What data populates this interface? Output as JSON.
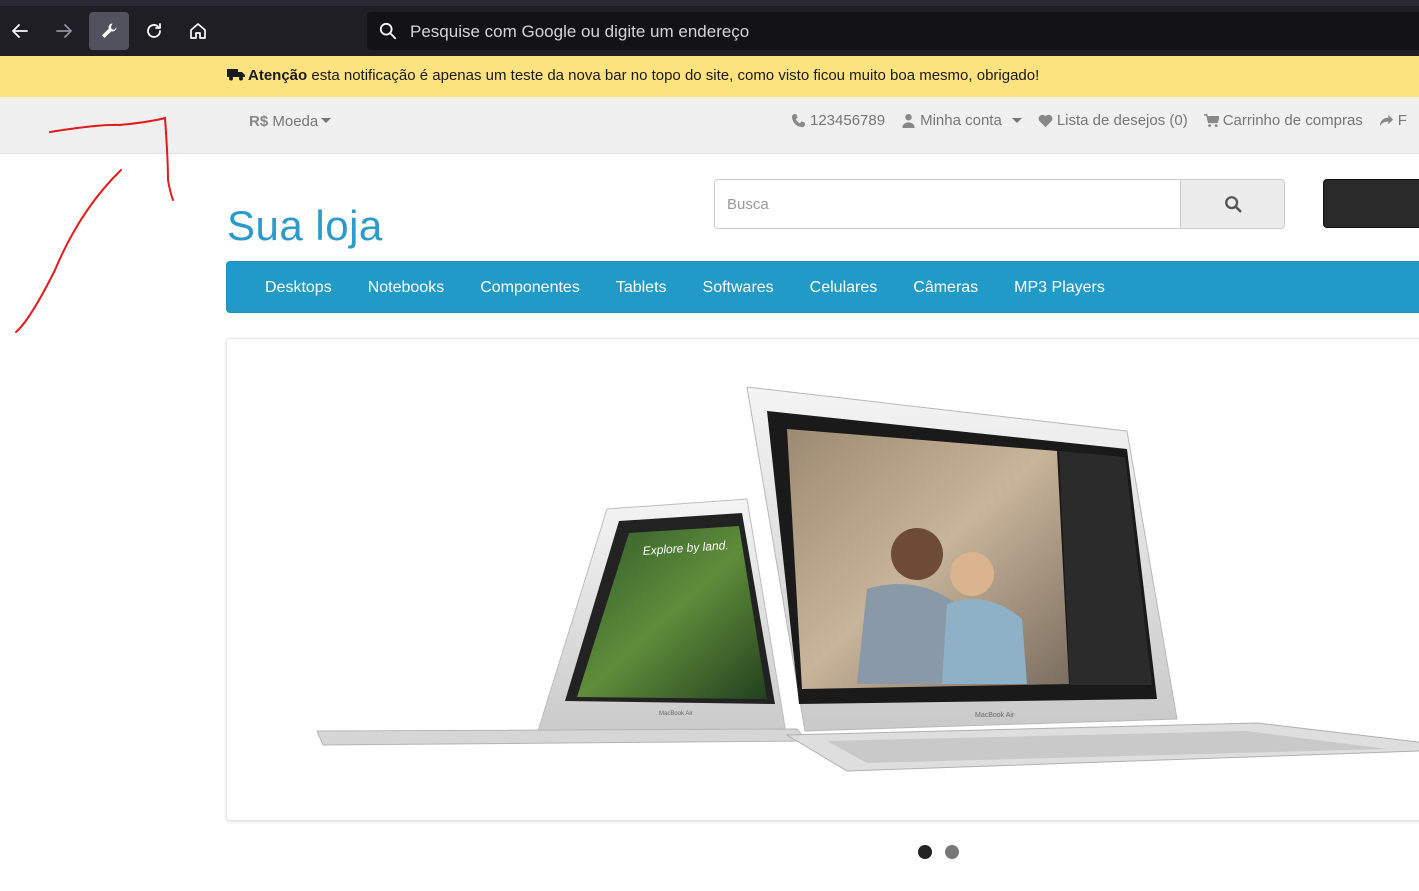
{
  "browser": {
    "url_placeholder": "Pesquise com Google ou digite um endereço"
  },
  "notice": {
    "bold": "Atenção",
    "text": " esta notificação é apenas um teste da nova bar no topo do site, como visto ficou muito boa mesmo, obrigado!"
  },
  "topbar": {
    "currency_symbol": "R$",
    "currency_label": "Moeda",
    "phone": "123456789",
    "account": "Minha conta",
    "wishlist": "Lista de desejos (0)",
    "cart": "Carrinho de compras",
    "checkout_partial": "F"
  },
  "header": {
    "logo": "Sua loja",
    "search_placeholder": "Busca"
  },
  "menu": {
    "items": [
      "Desktops",
      "Notebooks",
      "Componentes",
      "Tablets",
      "Softwares",
      "Celulares",
      "Câmeras",
      "MP3 Players"
    ]
  },
  "slideshow": {
    "laptop_small_text": "Explore by land.",
    "laptop_small_brand": "MacBook Air",
    "laptop_large_brand": "MacBook Air",
    "active_slide": 1,
    "slide_count": 2
  },
  "colors": {
    "notice_bg": "#fde37f",
    "menu_bg": "#229ac8",
    "logo": "#2b9bcd",
    "annotation": "#e31b1b"
  }
}
